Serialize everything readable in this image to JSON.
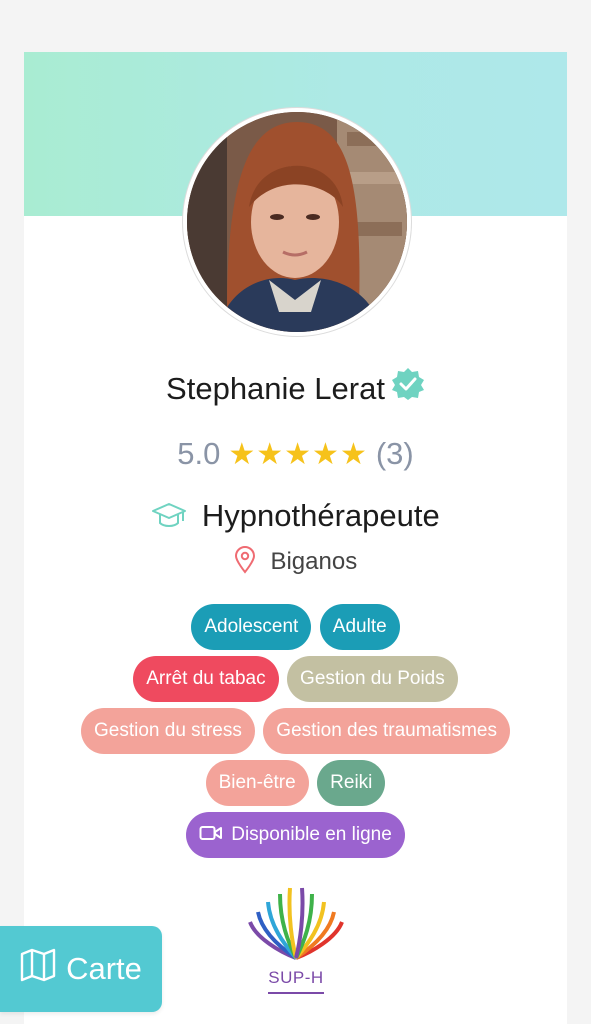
{
  "profile": {
    "name": "Stephanie Lerat",
    "rating": "5.0",
    "stars": "★★★★★",
    "reviews": "(3)",
    "profession": "Hypnothérapeute",
    "location": "Biganos"
  },
  "tags": {
    "adolescent": "Adolescent",
    "adulte": "Adulte",
    "arret_tabac": "Arrêt du tabac",
    "gestion_poids": "Gestion du Poids",
    "gestion_stress": "Gestion du stress",
    "gestion_traumatismes": "Gestion des traumatismes",
    "bien_etre": "Bien-être",
    "reiki": "Reiki",
    "online": "Disponible en ligne"
  },
  "logo": {
    "text": "SUP-H"
  },
  "map_button": {
    "label": "Carte"
  },
  "colors": {
    "teal_tag": "#1b9db6",
    "red_tag": "#ef4a5f",
    "khaki_tag": "#c3c0a2",
    "salmon_tag": "#f3a39a",
    "green_tag": "#6aa88d",
    "purple_tag": "#9b63cf",
    "map_button": "#53c9d2",
    "star": "#f6c21a",
    "verified": "#6fd3c1"
  }
}
